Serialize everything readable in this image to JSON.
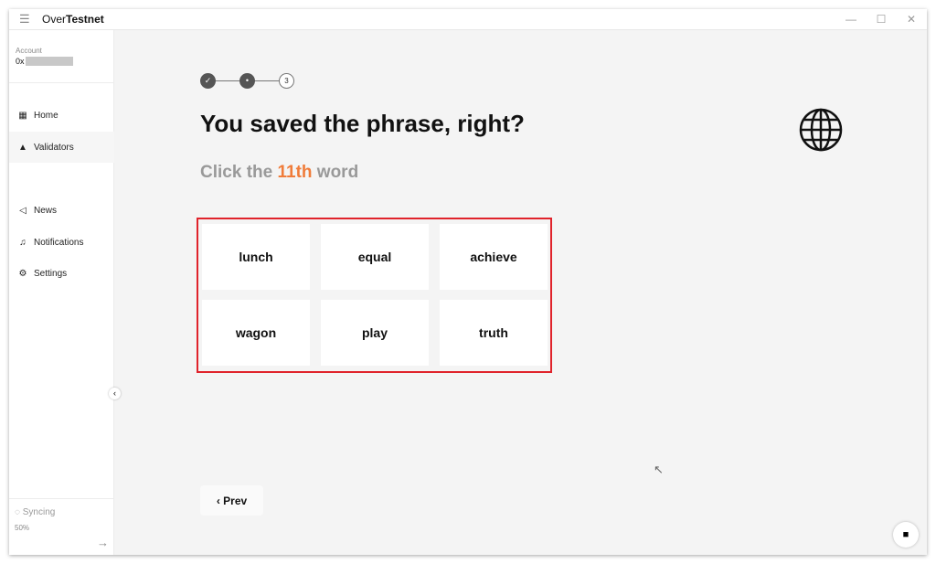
{
  "app": {
    "title_light": "Over",
    "title_bold": "Testnet"
  },
  "window_controls": {
    "minimize": "—",
    "maximize": "☐",
    "close": "✕"
  },
  "sidebar": {
    "account_label": "Account",
    "account_prefix": "0x",
    "items": [
      {
        "label": "Home",
        "icon": "grid-icon",
        "glyph": "▦"
      },
      {
        "label": "Validators",
        "icon": "user-icon",
        "glyph": "👤"
      },
      {
        "label": "News",
        "icon": "megaphone-icon",
        "glyph": "📢"
      },
      {
        "label": "Notifications",
        "icon": "bell-icon",
        "glyph": "🔔"
      },
      {
        "label": "Settings",
        "icon": "gear-icon",
        "glyph": "⚙"
      }
    ],
    "sync_label": "Syncing",
    "sync_percent": "50%",
    "sync_progress": 50
  },
  "stepper": {
    "step1": "✓",
    "step2": "•",
    "step3": "3",
    "current": 2
  },
  "main": {
    "title": "You saved the phrase, right?",
    "sub_prefix": "Click the ",
    "sub_highlight": "11th",
    "sub_suffix": " word",
    "words": [
      "lunch",
      "equal",
      "achieve",
      "wagon",
      "play",
      "truth"
    ],
    "prev_label": "Prev"
  },
  "colors": {
    "accent": "#f07c3a",
    "highlight_border": "#e0232b"
  }
}
